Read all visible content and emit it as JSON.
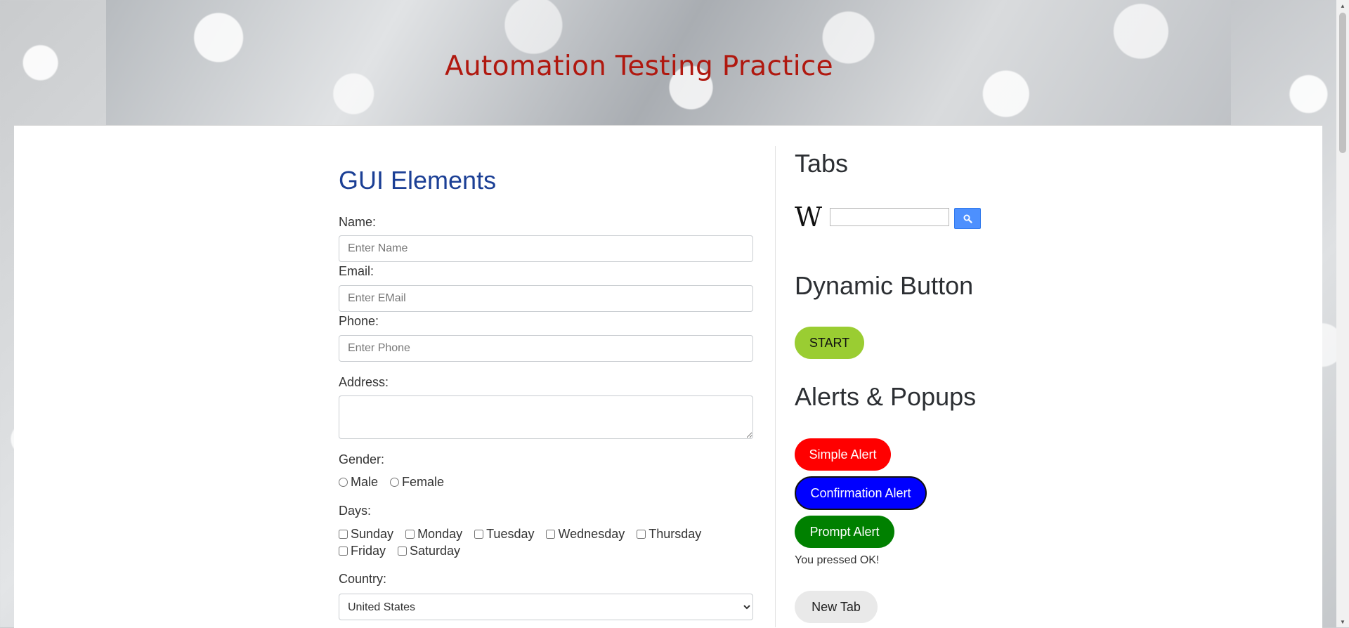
{
  "header": {
    "title": "Automation Testing Practice"
  },
  "gui": {
    "title": "GUI Elements",
    "name": {
      "label": "Name:",
      "placeholder": "Enter Name"
    },
    "email": {
      "label": "Email:",
      "placeholder": "Enter EMail"
    },
    "phone": {
      "label": "Phone:",
      "placeholder": "Enter Phone"
    },
    "address": {
      "label": "Address:"
    },
    "gender": {
      "label": "Gender:",
      "options": [
        "Male",
        "Female"
      ]
    },
    "days": {
      "label": "Days:",
      "options": [
        "Sunday",
        "Monday",
        "Tuesday",
        "Wednesday",
        "Thursday",
        "Friday",
        "Saturday"
      ]
    },
    "country": {
      "label": "Country:",
      "selected": "United States"
    }
  },
  "tabs": {
    "title": "Tabs",
    "wiki_logo": "W",
    "search_icon": "search-icon"
  },
  "dynamic": {
    "title": "Dynamic Button",
    "start_label": "START"
  },
  "alerts": {
    "title": "Alerts & Popups",
    "simple_label": "Simple Alert",
    "confirm_label": "Confirmation Alert",
    "prompt_label": "Prompt Alert",
    "result_text": "You pressed OK!",
    "new_tab_label": "New Tab"
  },
  "colors": {
    "title_red": "#b0180f",
    "gui_title_blue": "#1b3f95",
    "start_green": "#9acd32",
    "simple_red": "#ff0000",
    "confirm_blue": "#0000ff",
    "prompt_green": "#008000"
  }
}
